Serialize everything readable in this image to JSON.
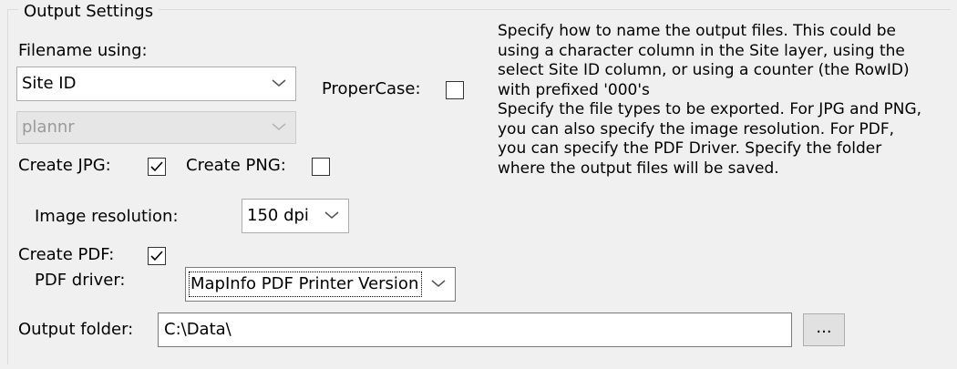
{
  "group": {
    "title": "Output Settings"
  },
  "filename": {
    "label": "Filename using:",
    "selected": "Site ID",
    "proper_case_label": "ProperCase:",
    "proper_case_checked": false,
    "disabled_selected": "plannr"
  },
  "jpg": {
    "label": "Create JPG:",
    "checked": true
  },
  "png": {
    "label": "Create PNG:",
    "checked": false
  },
  "resolution": {
    "label": "Image resolution:",
    "selected": "150 dpi"
  },
  "pdf": {
    "label": "Create PDF:",
    "checked": true,
    "driver_label": "PDF driver:",
    "driver_selected": "MapInfo PDF Printer Version"
  },
  "output": {
    "label": "Output folder:",
    "value": "C:\\Data\\",
    "browse_label": "..."
  },
  "help": {
    "text": "Specify how to name the output files. This could be using a character column in the Site layer, using the select Site ID column, or using a counter (the RowID) with prefixed '000's\nSpecify the file types to be exported. For JPG and PNG, you can also specify the image resolution. For PDF, you can specify the PDF Driver. Specify the folder where the output files will be saved."
  }
}
